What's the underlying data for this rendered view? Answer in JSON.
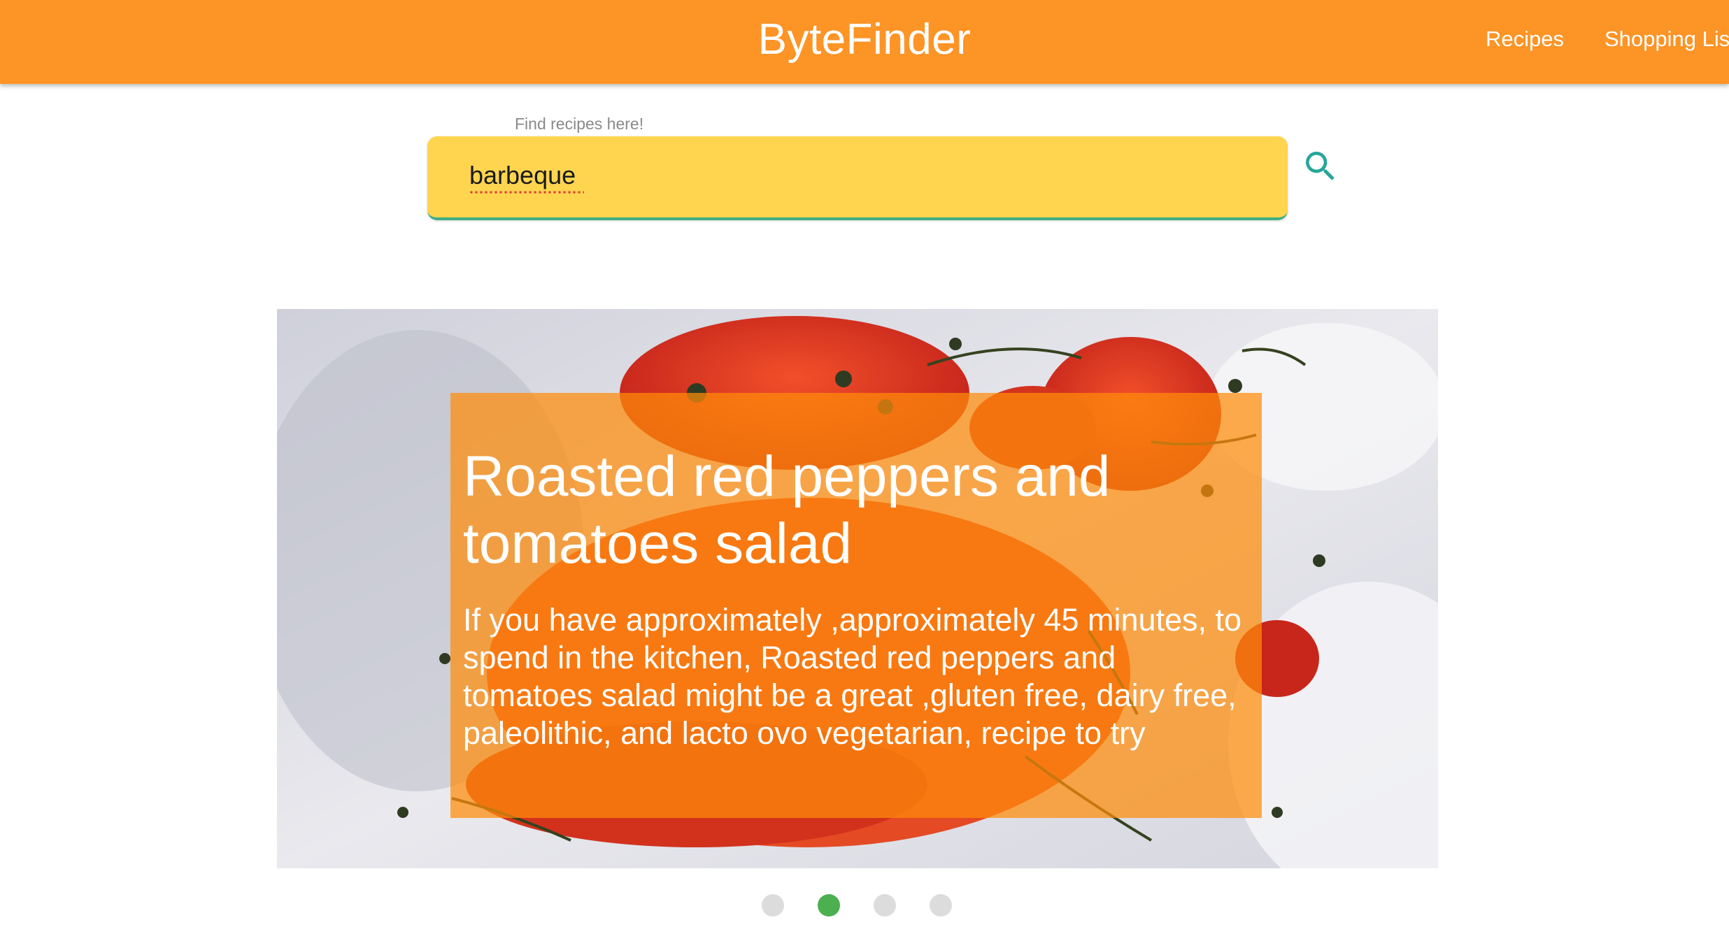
{
  "header": {
    "brand": "ByteFinder",
    "nav": {
      "recipes": "Recipes",
      "shopping_list": "Shopping List"
    },
    "color": "#fd9426"
  },
  "search": {
    "caption": "Find recipes here!",
    "value": "barbeque",
    "button_icon": "search-icon",
    "field_color": "#ffd54f",
    "accent_color": "#3fae83"
  },
  "carousel": {
    "slide": {
      "title": "Roasted red peppers and tomatoes salad",
      "description": "If you have approximately ,approximately 45 minutes, to spend in the kitchen, Roasted red peppers and tomatoes salad might be a great ,gluten free, dairy free, paleolithic, and lacto ovo vegetarian, recipe to try"
    },
    "slide_count": 4,
    "active_index": 2,
    "active_dot_color": "#4caf50"
  }
}
